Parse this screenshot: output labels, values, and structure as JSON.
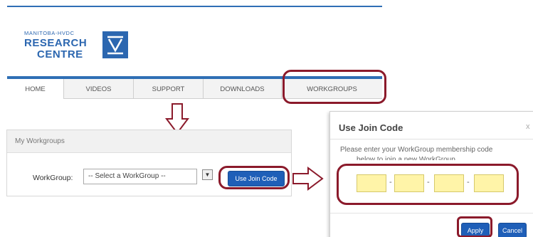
{
  "site": {
    "logo_line1": "MANITOBA-HVDC",
    "logo_line2": "RESEARCH",
    "logo_line3": "CENTRE",
    "logo_mark": "logo-v-mark"
  },
  "nav": {
    "items": [
      {
        "label": "HOME"
      },
      {
        "label": "VIDEOS"
      },
      {
        "label": "SUPPORT"
      },
      {
        "label": "DOWNLOADS"
      },
      {
        "label": "WORKGROUPS"
      }
    ]
  },
  "panel": {
    "title": "My Workgroups",
    "workgroup_label": "WorkGroup:",
    "select_value": "-- Select a WorkGroup --",
    "join_button": "Use Join Code"
  },
  "dialog": {
    "title": "Use Join Code",
    "close": "x",
    "message_line1": "Please enter your WorkGroup membership code",
    "message_line2": "below to join a new WorkGroup.",
    "separator": "-",
    "apply": "Apply",
    "cancel": "Cancel"
  },
  "colors": {
    "brand_blue": "#2c67b0",
    "button_blue": "#1f5fb8",
    "highlight": "#8b1a2b",
    "code_field": "#fff4a8"
  },
  "icons": {
    "down_arrow": "down-outline-arrow-icon",
    "right_arrow": "right-outline-arrow-icon",
    "select_arrow": "chevron-down-icon"
  }
}
